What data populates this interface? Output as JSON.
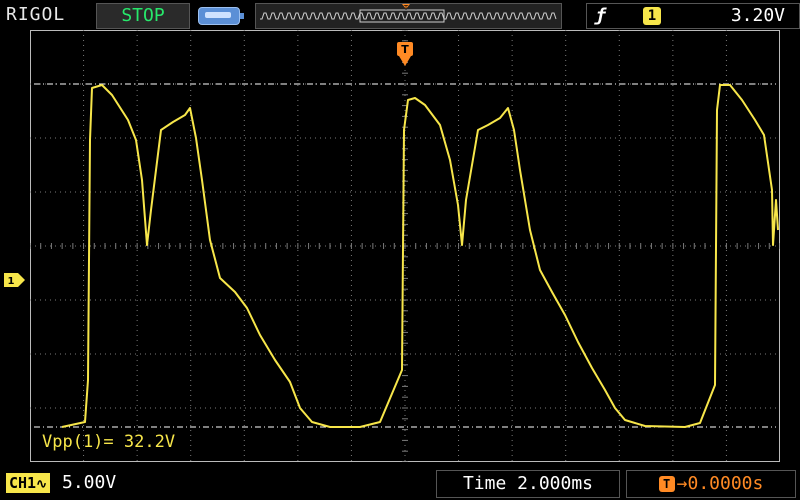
{
  "header": {
    "brand": "RIGOL",
    "run_state": "STOP",
    "trigger": {
      "edge_icon": "rising-edge-icon",
      "source": "1",
      "level": "3.20V"
    }
  },
  "screen": {
    "channel_marker": "1",
    "trigger_marker": "T",
    "timeline_marker": "T"
  },
  "measurement": {
    "label": "Vpp(1)= 32.2V"
  },
  "footer": {
    "channel_label": "CH1",
    "coupling_icon": "ac-coupling-icon",
    "channel_scale": "5.00V",
    "timebase": "Time 2.000ms",
    "trigger_offset_icon": "T",
    "trigger_offset": "0.0000s"
  },
  "colors": {
    "trace": "#f7e64a",
    "grid": "#7a7a7a",
    "stop": "#27e86b",
    "offset": "#ff8a24"
  }
}
